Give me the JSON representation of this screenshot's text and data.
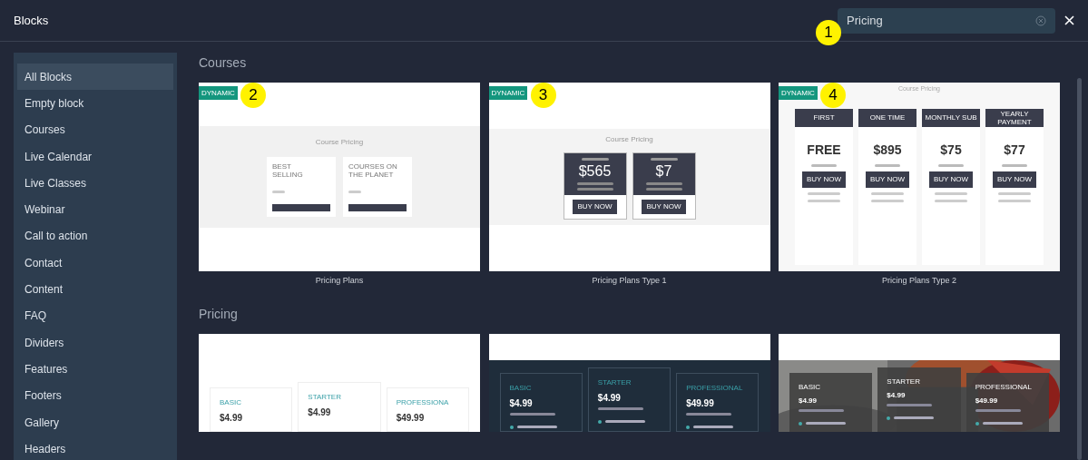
{
  "window": {
    "title": "Blocks"
  },
  "search": {
    "value": "Pricing",
    "marker": "1"
  },
  "sidebar": {
    "items": [
      {
        "label": "All Blocks",
        "selected": true
      },
      {
        "label": "Empty block",
        "selected": false
      },
      {
        "label": "Courses",
        "selected": false
      },
      {
        "label": "Live Calendar",
        "selected": false
      },
      {
        "label": "Live Classes",
        "selected": false
      },
      {
        "label": "Webinar",
        "selected": false
      },
      {
        "label": "Call to action",
        "selected": false
      },
      {
        "label": "Contact",
        "selected": false
      },
      {
        "label": "Content",
        "selected": false
      },
      {
        "label": "FAQ",
        "selected": false
      },
      {
        "label": "Dividers",
        "selected": false
      },
      {
        "label": "Features",
        "selected": false
      },
      {
        "label": "Footers",
        "selected": false
      },
      {
        "label": "Gallery",
        "selected": false
      },
      {
        "label": "Headers",
        "selected": false
      }
    ]
  },
  "sections": [
    {
      "title": "Courses",
      "blocks": [
        {
          "kind": "cards-light",
          "badge": "DYNAMIC",
          "marker": "2",
          "caption": "Pricing Plans",
          "heading": "Course Pricing",
          "cards": [
            {
              "title": "BEST SELLING"
            },
            {
              "title": "COURSES ON THE PLANET"
            }
          ]
        },
        {
          "kind": "cards-dark",
          "badge": "DYNAMIC",
          "marker": "3",
          "caption": "Pricing Plans Type 1",
          "heading": "Course Pricing",
          "cards": [
            {
              "price": "$565",
              "button": "BUY NOW"
            },
            {
              "price": "$7",
              "button": "BUY NOW"
            }
          ]
        },
        {
          "kind": "columns",
          "badge": "DYNAMIC",
          "marker": "4",
          "caption": "Pricing Plans Type 2",
          "heading": "Course Pricing",
          "columns": [
            {
              "header": "FIRST",
              "price": "FREE",
              "button": "BUY NOW"
            },
            {
              "header": "ONE TIME",
              "price": "$895",
              "button": "BUY NOW"
            },
            {
              "header": "MONTHLY SUB",
              "price": "$75",
              "button": "BUY NOW"
            },
            {
              "header": "YEARLY PAYMENT",
              "price": "$77",
              "button": "BUY NOW"
            }
          ]
        }
      ]
    },
    {
      "title": "Pricing",
      "blocks": [
        {
          "kind": "tiers-light",
          "tiers": [
            {
              "name": "BASIC",
              "price": "$4.99"
            },
            {
              "name": "STARTER",
              "price": "$4.99"
            },
            {
              "name": "PROFESSIONA",
              "price": "$49.99"
            }
          ]
        },
        {
          "kind": "tiers-dark",
          "tiers": [
            {
              "name": "BASIC",
              "price": "$4.99"
            },
            {
              "name": "STARTER",
              "price": "$4.99"
            },
            {
              "name": "PROFESSIONAL",
              "price": "$49.99"
            }
          ]
        },
        {
          "kind": "tiers-photo",
          "tiers": [
            {
              "name": "BASIC",
              "price": "$4.99"
            },
            {
              "name": "STARTER",
              "price": "$4.99"
            },
            {
              "name": "PROFESSIONAL",
              "price": "$49.99"
            }
          ]
        }
      ]
    }
  ]
}
